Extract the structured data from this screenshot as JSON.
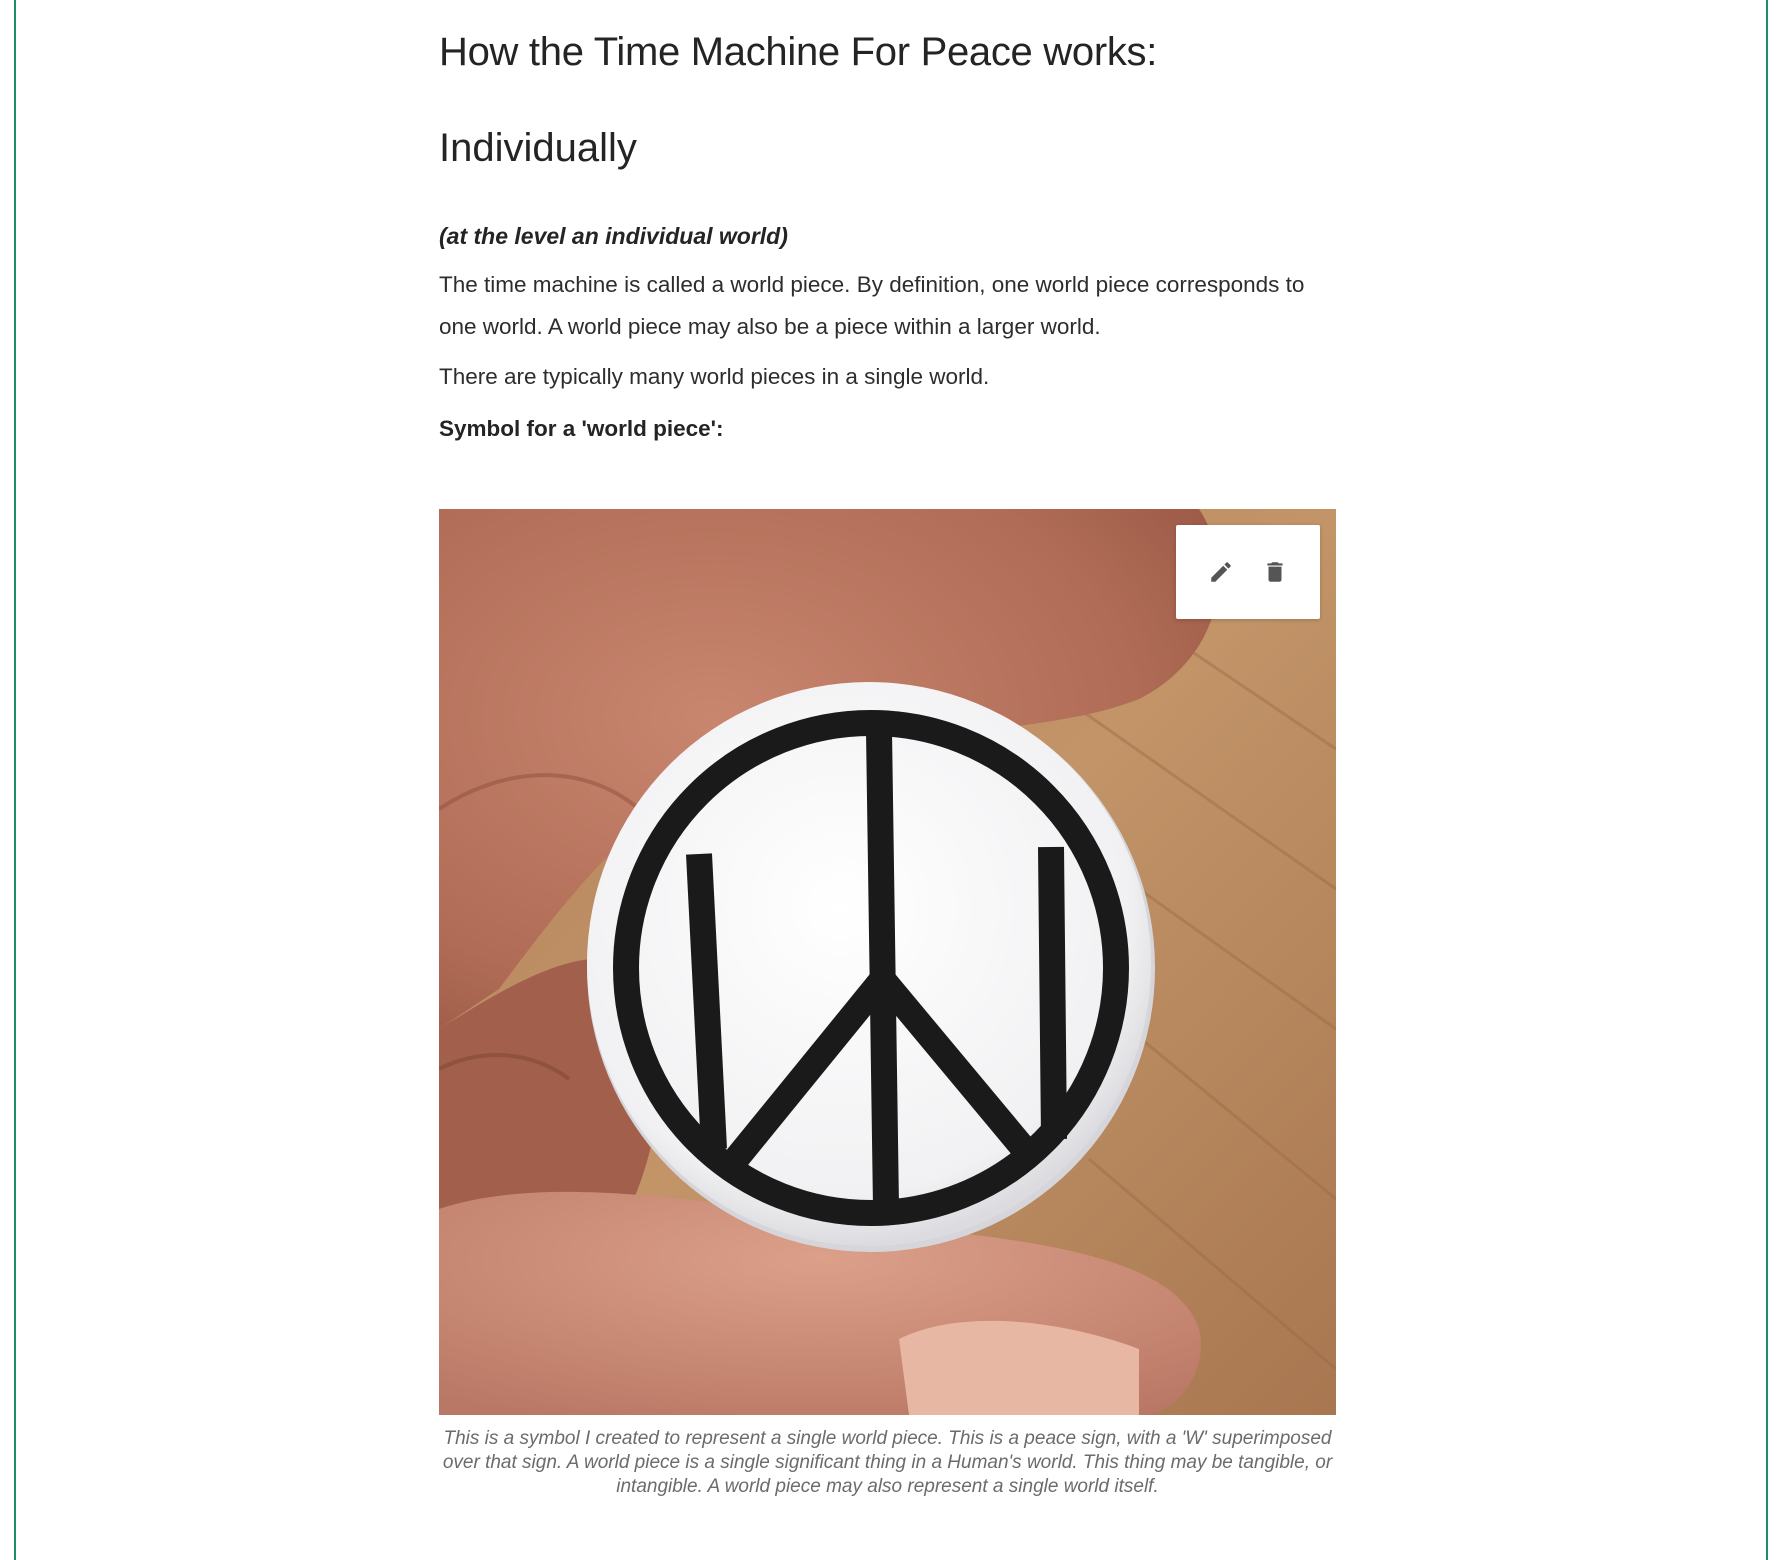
{
  "article": {
    "heading": "How the Time Machine For Peace works:",
    "subheading": "Individually",
    "level_note": "(at the level an individual world)",
    "paragraph_1": "The time machine is called a world piece. By definition, one world piece corresponds to one world. A world piece may also be a piece within a larger world.",
    "paragraph_2": "There are typically many world pieces in a single world.",
    "symbol_label": "Symbol for a 'world piece':"
  },
  "figure": {
    "image_subject": "Hand holding a white button badge with a peace sign and a superimposed 'W'",
    "caption": "This is a symbol I created to represent a single world piece. This is a peace sign, with a 'W' superimposed over that sign. A world piece is a single significant thing in a Human's world. This thing may be tangible, or intangible. A world piece may also represent a single world itself.",
    "toolbar": {
      "edit_icon": "pencil-icon",
      "delete_icon": "trash-icon"
    }
  },
  "colors": {
    "frame_border": "#1f8f63",
    "text": "#242424",
    "caption": "#6b6b6b",
    "toolbar_icon": "#555555"
  }
}
